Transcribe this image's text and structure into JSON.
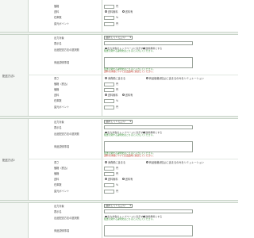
{
  "labels": {
    "unit_en": "円",
    "unit_pct": "%",
    "unit_ko": "個"
  },
  "radios": {
    "no_fee": "送料無料",
    "with_fee": "送料有",
    "apply": "消費税に含まる",
    "no_apply": "商品価格(税込)に含まるのみをシミュレーション"
  },
  "fields": {
    "price": "価格",
    "shipping": "送料",
    "stock": "在庫数",
    "points": "還元ポイント",
    "ratio": "数量",
    "tax": "価格（税込）",
    "qty": "出荷数",
    "weight": "重さ"
  },
  "block": {
    "select_label": "出力対象",
    "select_value": "選択してください",
    "name_label": "表示名",
    "options_label": "出品配送方法の選択肢",
    "check1": "出力対象のトップページに表示する",
    "check2": "送料無料とする",
    "desc_label": "商品説明事項",
    "note_green": "配送に関する説明文はこちらに入力してください。",
    "note_red": "送料の詳細については出品時に確認してください。"
  },
  "groups": [
    {
      "title": "配送方法1"
    },
    {
      "title": "配送方法2"
    }
  ]
}
